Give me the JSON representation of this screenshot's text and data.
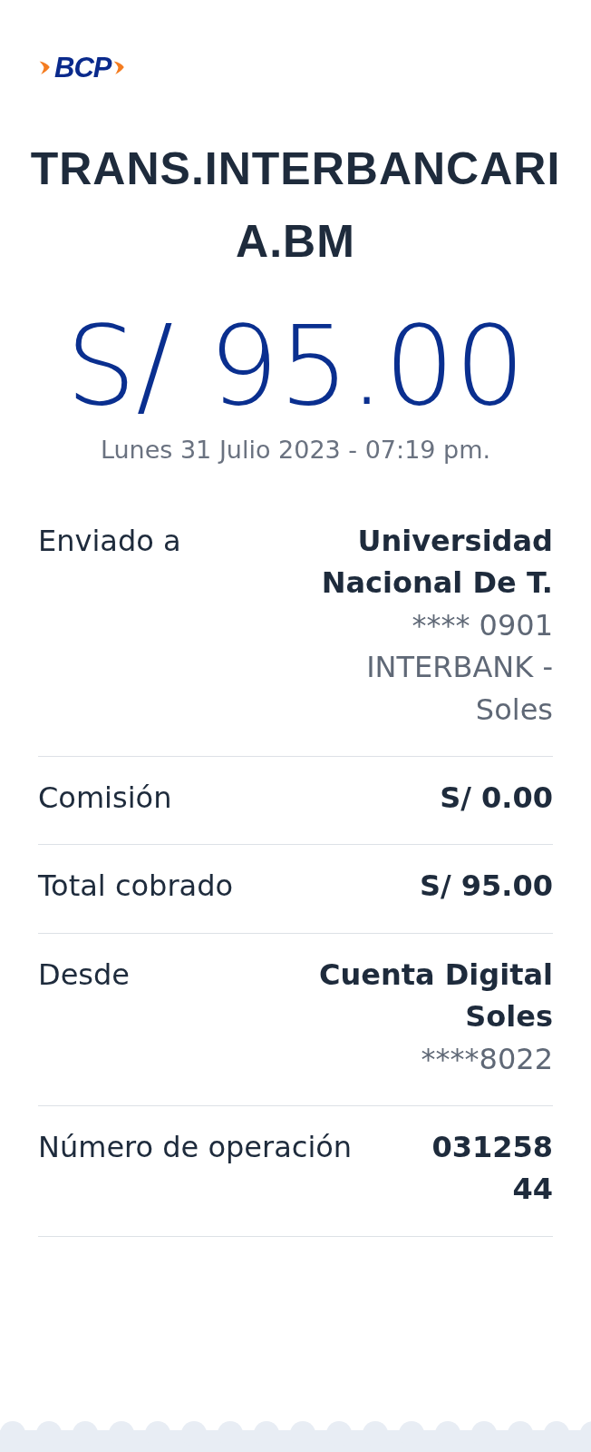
{
  "logo": {
    "text": "BCP"
  },
  "title": "TRANS.INTERBANCARIA.BM",
  "amount": "S/ 95.00",
  "date": "Lunes 31 Julio 2023 - 07:19 pm.",
  "details": [
    {
      "label": "Enviado a",
      "lines": [
        {
          "text": "Universidad Nacional De T.",
          "kind": "bold"
        },
        {
          "text": "**** 0901",
          "kind": "muted"
        },
        {
          "text": "INTERBANK - Soles",
          "kind": "muted"
        }
      ]
    },
    {
      "label": "Comisión",
      "lines": [
        {
          "text": "S/ 0.00",
          "kind": "bold"
        }
      ]
    },
    {
      "label": "Total cobrado",
      "lines": [
        {
          "text": "S/ 95.00",
          "kind": "bold"
        }
      ]
    },
    {
      "label": "Desde",
      "lines": [
        {
          "text": "Cuenta Digital Soles",
          "kind": "bold"
        },
        {
          "text": "****8022",
          "kind": "muted"
        }
      ]
    },
    {
      "label": "Número de operación",
      "lines": [
        {
          "text": "03125844",
          "kind": "code"
        }
      ]
    }
  ]
}
